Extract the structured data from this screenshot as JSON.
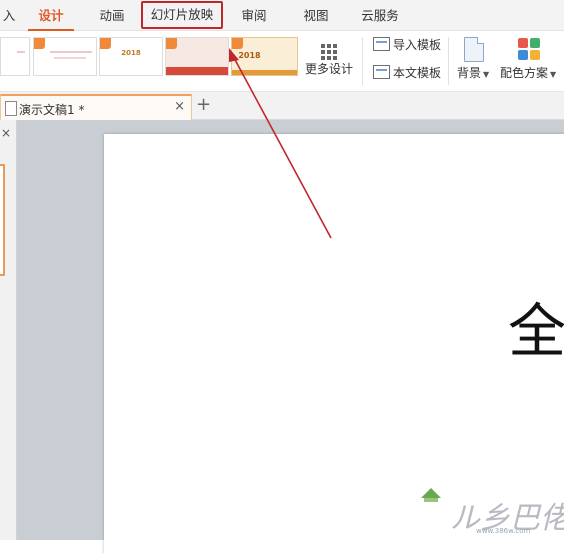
{
  "tabs": [
    {
      "label": "入",
      "state": "normal"
    },
    {
      "label": "设计",
      "state": "active"
    },
    {
      "label": "动画",
      "state": "normal"
    },
    {
      "label": "幻灯片放映",
      "state": "highlighted"
    },
    {
      "label": "审阅",
      "state": "normal"
    },
    {
      "label": "视图",
      "state": "normal"
    },
    {
      "label": "云服务",
      "state": "normal"
    }
  ],
  "ribbon": {
    "templates": [
      {
        "style": "light",
        "year": ""
      },
      {
        "style": "light",
        "year": ""
      },
      {
        "style": "light",
        "year": "2018"
      },
      {
        "style": "red",
        "year": ""
      },
      {
        "style": "gold",
        "year": "2018"
      }
    ],
    "more_design": "更多设计",
    "import_template": "导入模板",
    "text_template": "本文模板",
    "background": "背景",
    "color_scheme": "配色方案"
  },
  "document": {
    "tab_title": "演示文稿1 *",
    "close_glyph": "×",
    "new_tab_glyph": "+"
  },
  "left_pane": {
    "close_glyph": "×"
  },
  "slide": {
    "text": "全"
  },
  "watermark": {
    "text": "ル乡巴佬",
    "url": "www.386w.com"
  },
  "colors": {
    "accent": "#e05a28",
    "highlight_box": "#c0272d",
    "arrow": "#c0272d",
    "workspace_bg": "#c9cdd4"
  },
  "icons": {
    "more_design": "grid-icon",
    "import_template": "import-icon",
    "text_template": "template-icon",
    "background": "document-icon",
    "color_scheme": "palette-icon",
    "doc_tab": "file-icon"
  }
}
